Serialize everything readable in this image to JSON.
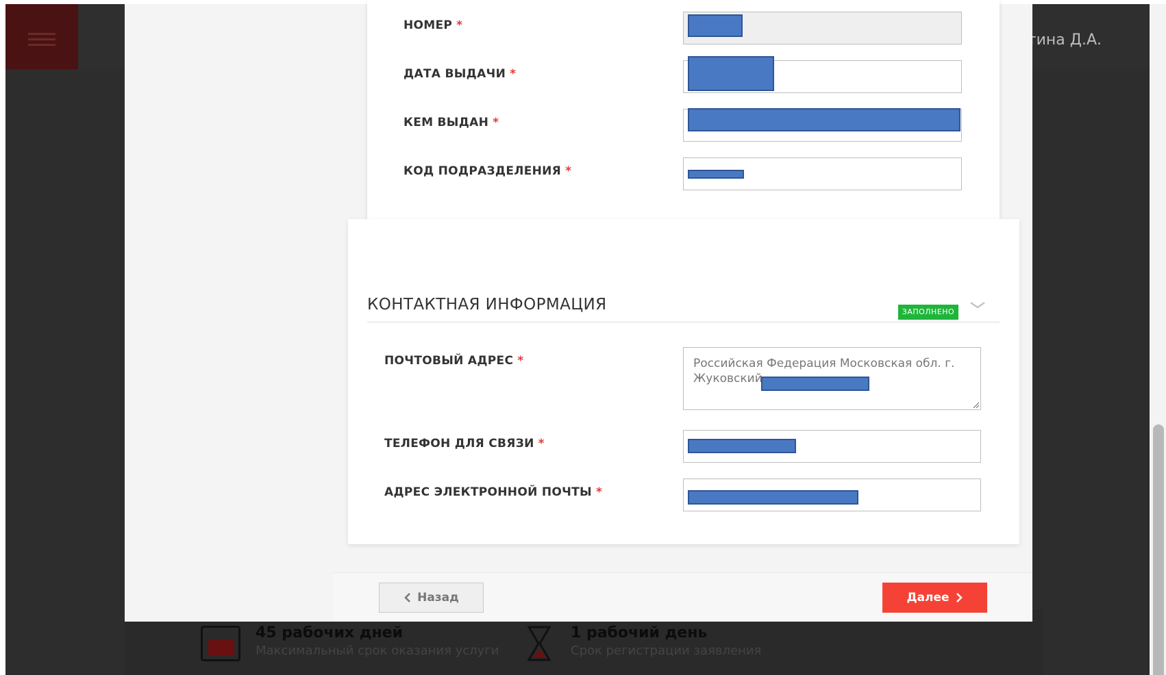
{
  "background": {
    "user_name_fragment": "остина Д.А.",
    "stat1": {
      "value": "45 рабочих дней",
      "caption": "Максимальный срок оказания услуги"
    },
    "stat2": {
      "value": "1 рабочий день",
      "caption": "Срок регистрации заявления"
    }
  },
  "passport": {
    "fields": [
      {
        "label": "НОМЕР",
        "required": "*"
      },
      {
        "label": "ДАТА ВЫДАЧИ",
        "required": "*"
      },
      {
        "label": "КЕМ ВЫДАН",
        "required": "*"
      },
      {
        "label": "КОД ПОДРАЗДЕЛЕНИЯ",
        "required": "*"
      }
    ]
  },
  "contact": {
    "title": "КОНТАКТНАЯ ИНФОРМАЦИЯ",
    "status_badge": "ЗАПОЛНЕНО",
    "fields": [
      {
        "label": "ПОЧТОВЫЙ АДРЕС",
        "required": "*",
        "value": "Российская Федерация Московская обл.   г. Жуковский"
      },
      {
        "label": "ТЕЛЕФОН ДЛЯ СВЯЗИ",
        "required": "*"
      },
      {
        "label": "АДРЕС ЭЛЕКТРОННОЙ ПОЧТЫ",
        "required": "*"
      }
    ]
  },
  "footer": {
    "back_label": "Назад",
    "next_label": "Далее"
  },
  "colors": {
    "accent_red": "#f44336",
    "badge_green": "#1fb53a",
    "redaction_blue": "#4a79c4"
  }
}
